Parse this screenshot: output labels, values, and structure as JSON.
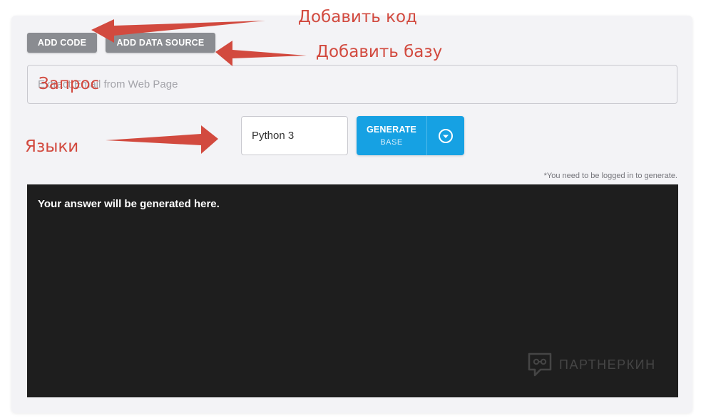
{
  "toolbar": {
    "add_code_label": "ADD CODE",
    "add_data_source_label": "ADD DATA SOURCE"
  },
  "query": {
    "placeholder": "Extract Email from Web Page"
  },
  "language": {
    "selected": "Python 3"
  },
  "generate": {
    "label": "GENERATE",
    "sublabel": "BASE",
    "dropdown_icon": "chevron-circle-down-icon"
  },
  "note": "*You need to be logged in to generate.",
  "output": {
    "text": "Your answer will be generated here."
  },
  "watermark": {
    "text": "ПАРТНЕРКИН"
  },
  "annotations": {
    "add_code": "Добавить код",
    "add_data_source": "Добавить базу",
    "query": "Запрос",
    "languages": "Языки"
  },
  "colors": {
    "accent": "#16a1e3",
    "button_gray": "#8a8c91",
    "output_bg": "#1e1e1e",
    "annotation": "#d24a3f"
  }
}
